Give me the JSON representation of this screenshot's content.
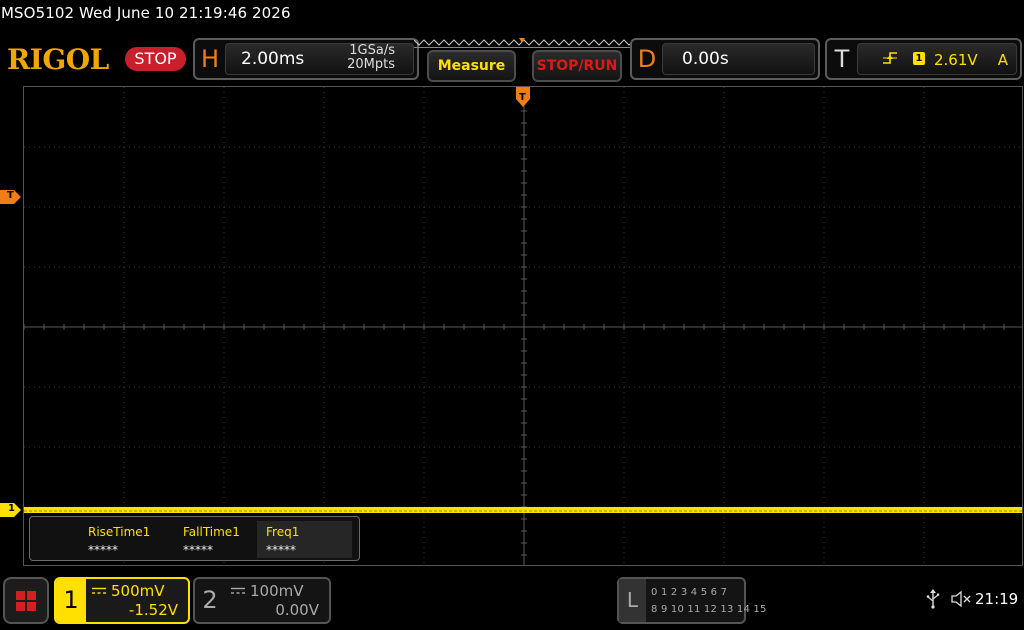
{
  "title_line": "MSO5102  Wed June 10 21:19:46 2026",
  "brand": {
    "logo": "RIGOL",
    "logo_color": "#f0a800"
  },
  "run_status": {
    "label": "STOP",
    "color": "#c8202a"
  },
  "horizontal": {
    "letter": "H",
    "timebase": "2.00ms",
    "sample_rate": "1GSa/s",
    "memory_depth": "20Mpts"
  },
  "buttons": {
    "measure": "Measure",
    "stop_run": "STOP/RUN"
  },
  "delay": {
    "letter": "D",
    "value": "0.00s"
  },
  "trigger": {
    "letter": "T",
    "edge_icon": "rising-edge-icon",
    "source": "1",
    "level": "2.61V",
    "mode": "A"
  },
  "screen_markers": {
    "trigger_position": "T",
    "trigger_level": "T",
    "channel1": "1"
  },
  "measurements": [
    {
      "label": "RiseTime1",
      "value": "*****"
    },
    {
      "label": "FallTime1",
      "value": "*****"
    },
    {
      "label": "Freq1",
      "value": "*****"
    }
  ],
  "channels": [
    {
      "number": "1",
      "coupling_icon": "dc-coupling-icon",
      "scale": "500mV",
      "offset": "-1.52V",
      "color": "#ffe000"
    },
    {
      "number": "2",
      "coupling_icon": "dc-coupling-icon",
      "scale": "100mV",
      "offset": "0.00V",
      "color": "#aaaaaa"
    }
  ],
  "logic": {
    "letter": "L",
    "row1": "0 1 2 3   4 5 6 7",
    "row2": "8  9 10 11  12 13 14 15"
  },
  "status_bar": {
    "clock": "21:19",
    "usb_icon": "usb-icon",
    "speaker_icon": "speaker-muted-icon"
  }
}
